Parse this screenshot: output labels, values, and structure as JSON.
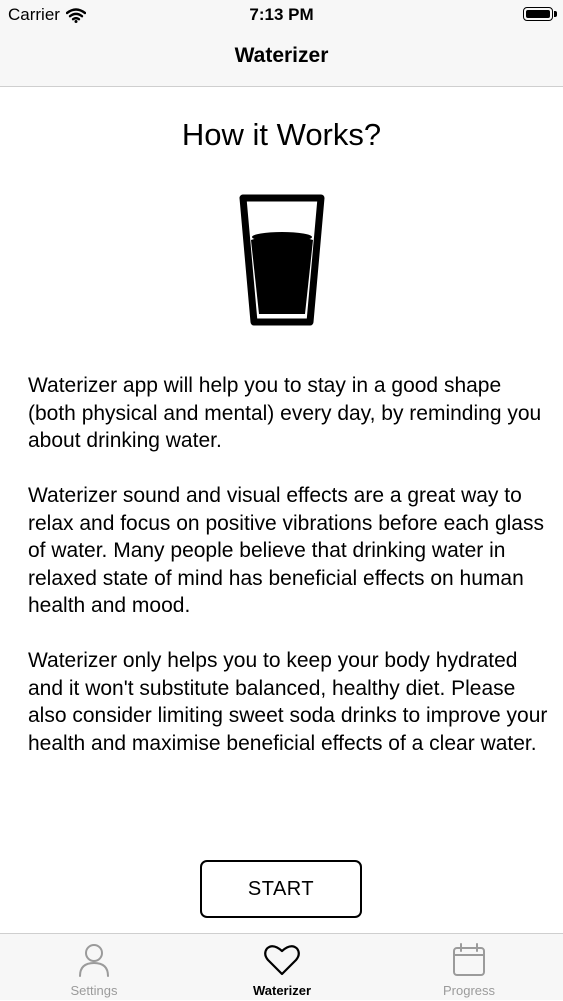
{
  "status_bar": {
    "carrier": "Carrier",
    "time": "7:13 PM"
  },
  "nav": {
    "title": "Waterizer"
  },
  "main": {
    "heading": "How it Works?",
    "paragraphs": [
      "Waterizer app will help you to stay in a good shape (both physical and mental) every day, by reminding you about drinking water.",
      "Waterizer sound and visual effects are a great way to relax and focus on positive vibrations before each glass of water. Many people believe that drinking water in relaxed state of mind has beneficial effects on human health and mood.",
      "Waterizer only helps you to keep your body hydrated and it won't substitute balanced, healthy diet. Please also consider limiting sweet soda drinks to improve your health and maximise beneficial effects of a clear water."
    ],
    "start_label": "START"
  },
  "tabs": [
    {
      "label": "Settings",
      "icon": "person-icon"
    },
    {
      "label": "Waterizer",
      "icon": "heart-icon",
      "active": true
    },
    {
      "label": "Progress",
      "icon": "calendar-icon"
    }
  ]
}
